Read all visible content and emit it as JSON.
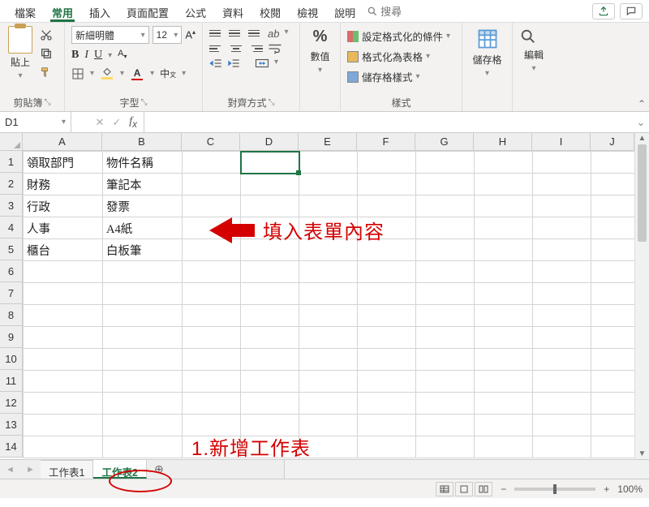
{
  "menu": {
    "file": "檔案",
    "home": "常用",
    "insert": "插入",
    "page_layout": "頁面配置",
    "formulas": "公式",
    "data": "資料",
    "review": "校閱",
    "view": "檢視",
    "help": "說明",
    "search": "搜尋"
  },
  "ribbon": {
    "clipboard": {
      "paste": "貼上",
      "label": "剪貼簿"
    },
    "font": {
      "name": "新細明體",
      "size": "12",
      "label": "字型"
    },
    "align": {
      "label": "對齊方式"
    },
    "number": {
      "symbol": "%",
      "label": "數值"
    },
    "styles": {
      "cond": "設定格式化的條件",
      "table": "格式化為表格",
      "cell": "儲存格樣式",
      "label": "樣式"
    },
    "cells": {
      "label": "儲存格"
    },
    "editing": {
      "label": "編輯"
    }
  },
  "name_box": "D1",
  "columns": [
    "A",
    "B",
    "C",
    "D",
    "E",
    "F",
    "G",
    "H",
    "I",
    "J"
  ],
  "rows": [
    "1",
    "2",
    "3",
    "4",
    "5",
    "6",
    "7",
    "8",
    "9",
    "10",
    "11",
    "12",
    "13",
    "14"
  ],
  "cells": {
    "A1": "領取部門",
    "B1": "物件名稱",
    "A2": "財務",
    "B2": "筆記本",
    "A3": "行政",
    "B3": "發票",
    "A4": "人事",
    "B4": "A4紙",
    "A5": "櫃台",
    "B5": "白板筆"
  },
  "annotations": {
    "fill": "填入表單內容",
    "new_sheet": "1.新增工作表"
  },
  "sheets": {
    "s1": "工作表1",
    "s2": "工作表2"
  },
  "status": {
    "zoom": "100%"
  }
}
